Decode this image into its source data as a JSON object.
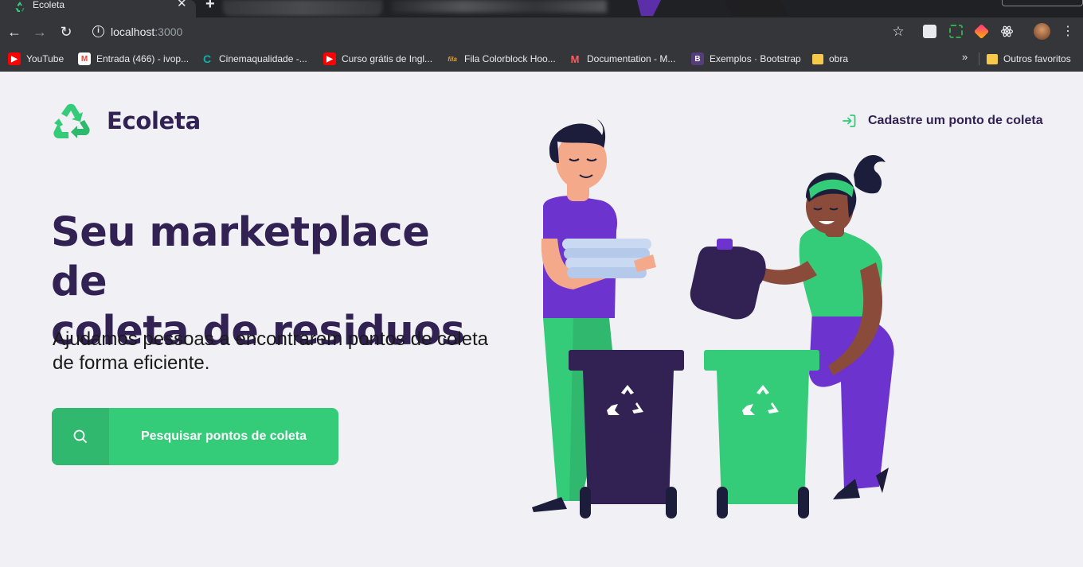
{
  "browser": {
    "tab_title": "Ecoleta",
    "tab_close": "✕",
    "new_tab": "+",
    "url_host": "localhost",
    "url_port": ":3000",
    "info_symbol": "i",
    "bookmarks": [
      {
        "label": "YouTube",
        "icon": "youtube-icon",
        "color": "#ff0000"
      },
      {
        "label": "Entrada (466) - ivop...",
        "icon": "gmail-icon",
        "color": "#ea4335"
      },
      {
        "label": "Cinemaqualidade -...",
        "icon": "cinema-icon",
        "color": "#0ab3a5"
      },
      {
        "label": "Curso grátis de Ingl...",
        "icon": "youtube-icon",
        "color": "#ff0000"
      },
      {
        "label": "Fila Colorblock Hoo...",
        "icon": "fila-icon",
        "color": "#d9a441"
      },
      {
        "label": "Documentation - M...",
        "icon": "material-icon",
        "color": "#ff5a5f"
      },
      {
        "label": "Exemplos · Bootstrap",
        "icon": "bootstrap-icon",
        "color": "#563d7c"
      },
      {
        "label": "obra",
        "icon": "folder-icon",
        "color": "#f7c94b"
      }
    ],
    "more_bookmarks": "»",
    "other_favorites": "Outros favoritos"
  },
  "page": {
    "brand": "Ecoleta",
    "register_link": "Cadastre um ponto de coleta",
    "title_line1": "Seu marketplace de",
    "title_line2": "coleta de residuos",
    "subtitle": "Ajudamos pessoas a encontrarem pontos de coleta de forma eficiente.",
    "search_button": "Pesquisar pontos de coleta"
  },
  "colors": {
    "primary": "#34cb79",
    "title": "#322153",
    "background": "#f0f0f5"
  }
}
